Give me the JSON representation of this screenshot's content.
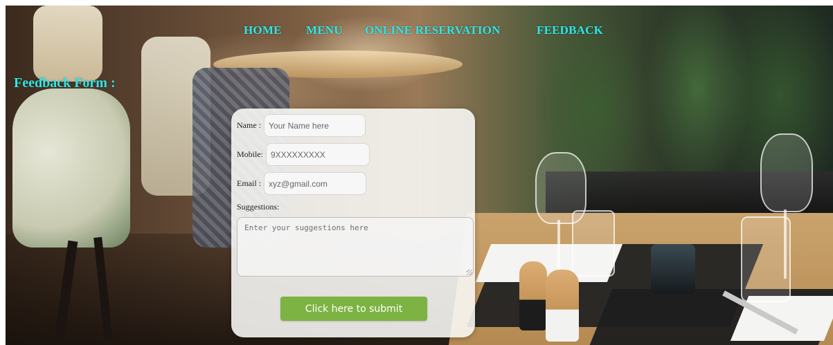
{
  "nav": {
    "items": [
      {
        "label": "HOME"
      },
      {
        "label": "MENU"
      },
      {
        "label": "ONLINE RESERVATION"
      },
      {
        "label": "FEEDBACK"
      }
    ],
    "color": "#2ee6e6"
  },
  "heading": "Feedback Form :",
  "form": {
    "name": {
      "label": "Name :",
      "placeholder": "Your Name here"
    },
    "mobile": {
      "label": "Mobile:",
      "placeholder": "9XXXXXXXXX"
    },
    "email": {
      "label": "Email :",
      "placeholder": "xyz@gmail.com"
    },
    "suggestions": {
      "label": "Suggestions:",
      "placeholder": "Enter your suggestions here"
    },
    "submit_label": "Click here to submit",
    "submit_color": "#7cb342"
  }
}
